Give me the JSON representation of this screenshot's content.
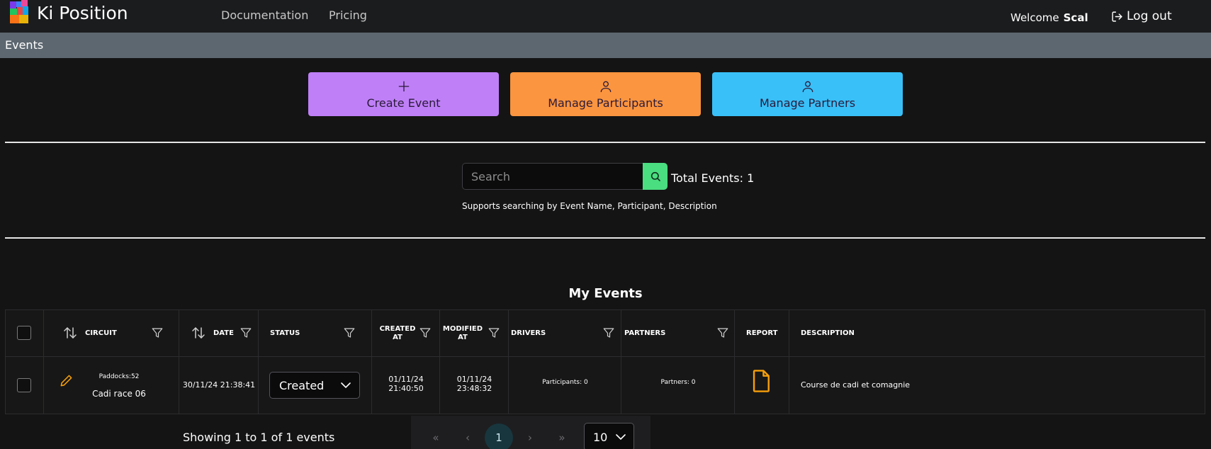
{
  "header": {
    "brand": "Ki Position",
    "nav": [
      "Documentation",
      "Pricing"
    ],
    "welcome_label": "Welcome",
    "username": "Scal",
    "logout_label": "Log out"
  },
  "breadcrumb": "Events",
  "actions": {
    "create": "Create Event",
    "participants": "Manage Participants",
    "partners": "Manage Partners"
  },
  "search": {
    "placeholder": "Search",
    "total": "Total Events: 1",
    "hint": "Supports searching by Event Name, Participant, Description"
  },
  "table": {
    "title": "My Events",
    "headers": {
      "circuit": "CIRCUIT",
      "date": "DATE",
      "status": "STATUS",
      "created_1": "CREATED",
      "created_2": "AT",
      "modified_1": "MODIFIED",
      "modified_2": "AT",
      "drivers": "DRIVERS",
      "partners": "PARTNERS",
      "report": "REPORT",
      "description": "DESCRIPTION"
    },
    "rows": [
      {
        "paddocks": "Paddocks:52",
        "circuit": "Cadi race 06",
        "date": "30/11/24 21:38:41",
        "status": "Created",
        "created_date": "01/11/24",
        "created_time": "21:40:50",
        "modified_date": "01/11/24",
        "modified_time": "23:48:32",
        "drivers": "Participants: 0",
        "partners": "Partners: 0",
        "description": "Course de cadi et comagnie"
      }
    ]
  },
  "pagination": {
    "showing": "Showing 1 to 1 of 1 events",
    "first": "«",
    "prev": "‹",
    "page": "1",
    "next": "›",
    "last": "»",
    "rows_per_page": "10"
  },
  "colors": {
    "create": "#bf80f7",
    "participants": "#fc953f",
    "partners": "#39c0f8",
    "search_button": "#4ade80",
    "edit_icon": "#f59e0b",
    "report_icon": "#f59e0b"
  }
}
